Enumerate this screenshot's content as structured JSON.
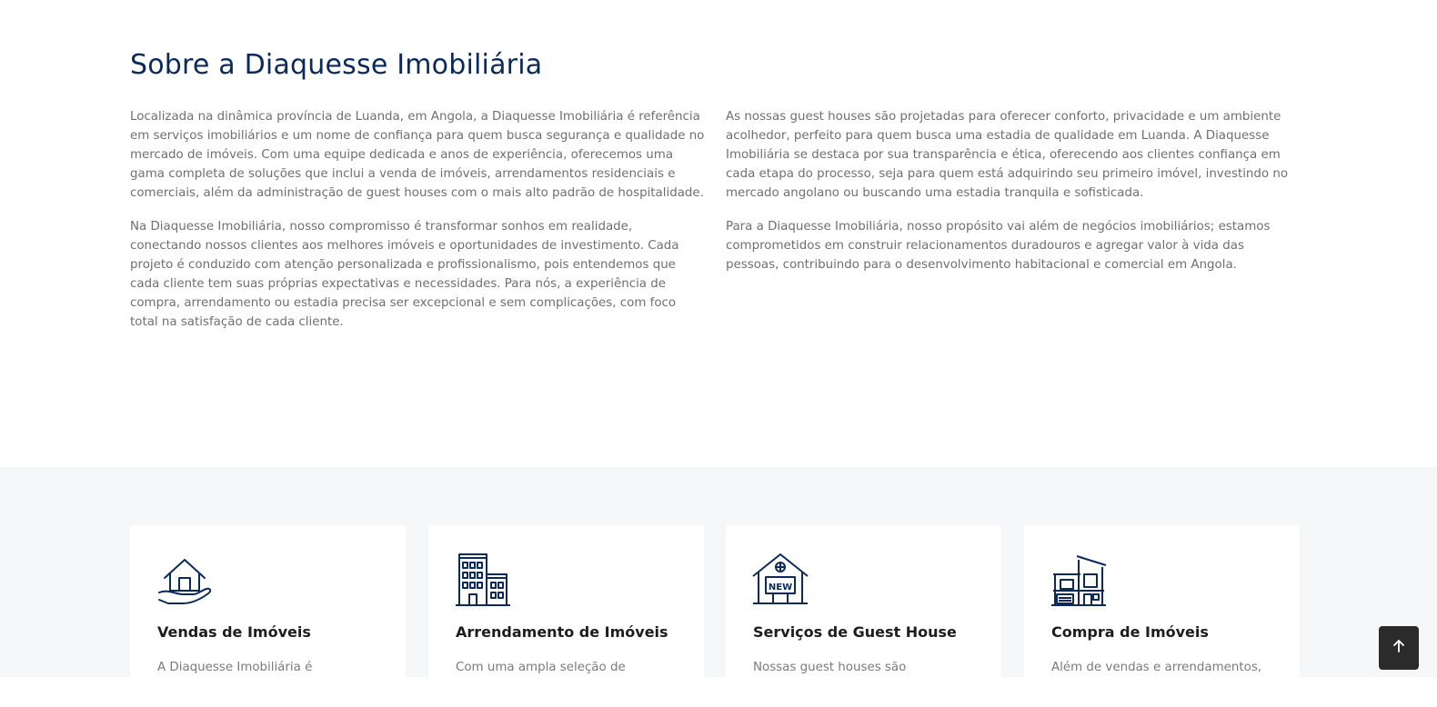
{
  "about": {
    "title": "Sobre a Diaquesse Imobiliária",
    "left_paragraphs": [
      "Localizada na dinâmica província de Luanda, em Angola, a Diaquesse Imobiliária é referência em serviços imobiliários e um nome de confiança para quem busca segurança e qualidade no mercado de imóveis. Com uma equipe dedicada e anos de experiência, oferecemos uma gama completa de soluções que inclui a venda de imóveis, arrendamentos residenciais e comerciais, além da administração de guest houses com o mais alto padrão de hospitalidade.",
      "Na Diaquesse Imobiliária, nosso compromisso é transformar sonhos em realidade, conectando nossos clientes aos melhores imóveis e oportunidades de investimento. Cada projeto é conduzido com atenção personalizada e profissionalismo, pois entendemos que cada cliente tem suas próprias expectativas e necessidades. Para nós, a experiência de compra, arrendamento ou estadia precisa ser excepcional e sem complicações, com foco total na satisfação de cada cliente."
    ],
    "right_paragraphs": [
      "As nossas guest houses são projetadas para oferecer conforto, privacidade e um ambiente acolhedor, perfeito para quem busca uma estadia de qualidade em Luanda. A Diaquesse Imobiliária se destaca por sua transparência e ética, oferecendo aos clientes confiança em cada etapa do processo, seja para quem está adquirindo seu primeiro imóvel, investindo no mercado angolano ou buscando uma estadia tranquila e sofisticada.",
      "Para a Diaquesse Imobiliária, nosso propósito vai além de negócios imobiliários; estamos comprometidos em construir relacionamentos duradouros e agregar valor à vida das pessoas, contribuindo para o desenvolvimento habitacional e comercial em Angola."
    ]
  },
  "services": [
    {
      "icon": "house-in-hand-icon",
      "title": "Vendas de Imóveis",
      "description": "A Diaquesse Imobiliária é"
    },
    {
      "icon": "buildings-icon",
      "title": "Arrendamento de Imóveis",
      "description": "Com uma ampla seleção de"
    },
    {
      "icon": "new-house-sign-icon",
      "title": "Serviços de Guest House",
      "description": "Nossas guest houses são"
    },
    {
      "icon": "modern-house-icon",
      "title": "Compra de Imóveis",
      "description": "Além de vendas e arrendamentos,"
    }
  ],
  "back_to_top": {
    "icon": "arrow-up-icon"
  },
  "colors": {
    "title": "#0b2a5b",
    "icon_stroke": "#0b2a5b",
    "body_text": "#6f6f6f",
    "section_bg": "#f6f7f9",
    "button_bg": "#2b2b2b"
  }
}
